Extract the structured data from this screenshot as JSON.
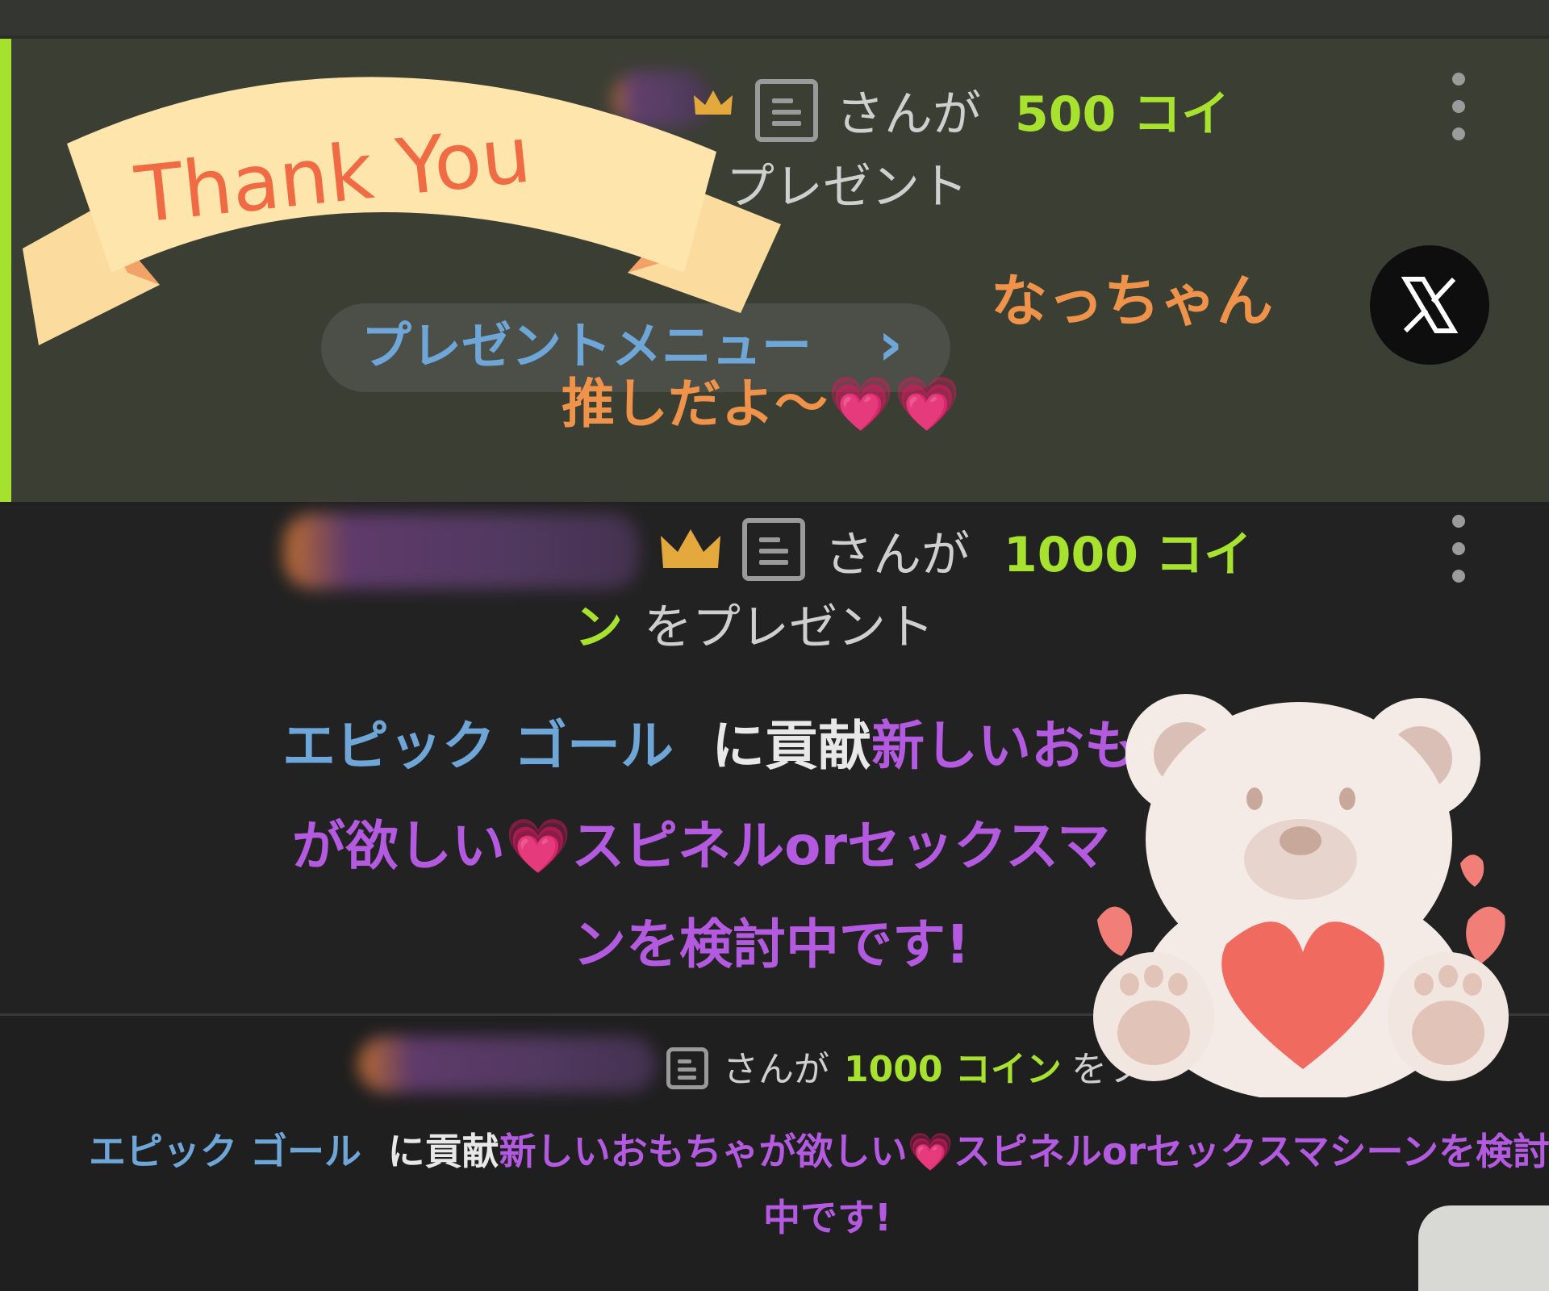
{
  "card1": {
    "suffix_san_ga": "さんが",
    "amount": "500 コイ",
    "present_line": "プレゼント",
    "present_menu_label": "プレゼントメニュー",
    "menu_chevron": "›",
    "nickname": "なっちゃん",
    "message": "推しだよ〜",
    "hearts": "💗💗",
    "sticker_text": "Thank You"
  },
  "card2": {
    "suffix_san_ga": "さんが",
    "amount": "1000 コイ",
    "amount_tail": "ン",
    "present_line": "をプレゼント",
    "goal_label": "エピック ゴール",
    "contrib": "に貢献",
    "message_line1": "新しいおも",
    "message_line2a": "が欲しい",
    "heart": "💗",
    "message_line2b": "スピネルorセックスマ",
    "message_line3": "ンを検討中です!"
  },
  "card3": {
    "suffix_san_ga": "さんが",
    "amount": "1000 コイン",
    "present_partial": "をフ",
    "goal_label": "エピック ゴール",
    "contrib": "に貢献",
    "message_a": "新しいおもちゃが欲しい",
    "heart": "💗",
    "message_b": "スピネルorセックスマシーンを検討",
    "message_line2": "中です!"
  },
  "icons": {
    "crown": "crown-icon",
    "doc": "document-icon",
    "kebab": "more-vertical-icon",
    "x": "x-logo-icon"
  },
  "colors": {
    "accent_green": "#a6e22e",
    "goal_blue": "#6ea6d8",
    "message_purple": "#b35ae0",
    "message_orange": "#f0934a"
  }
}
